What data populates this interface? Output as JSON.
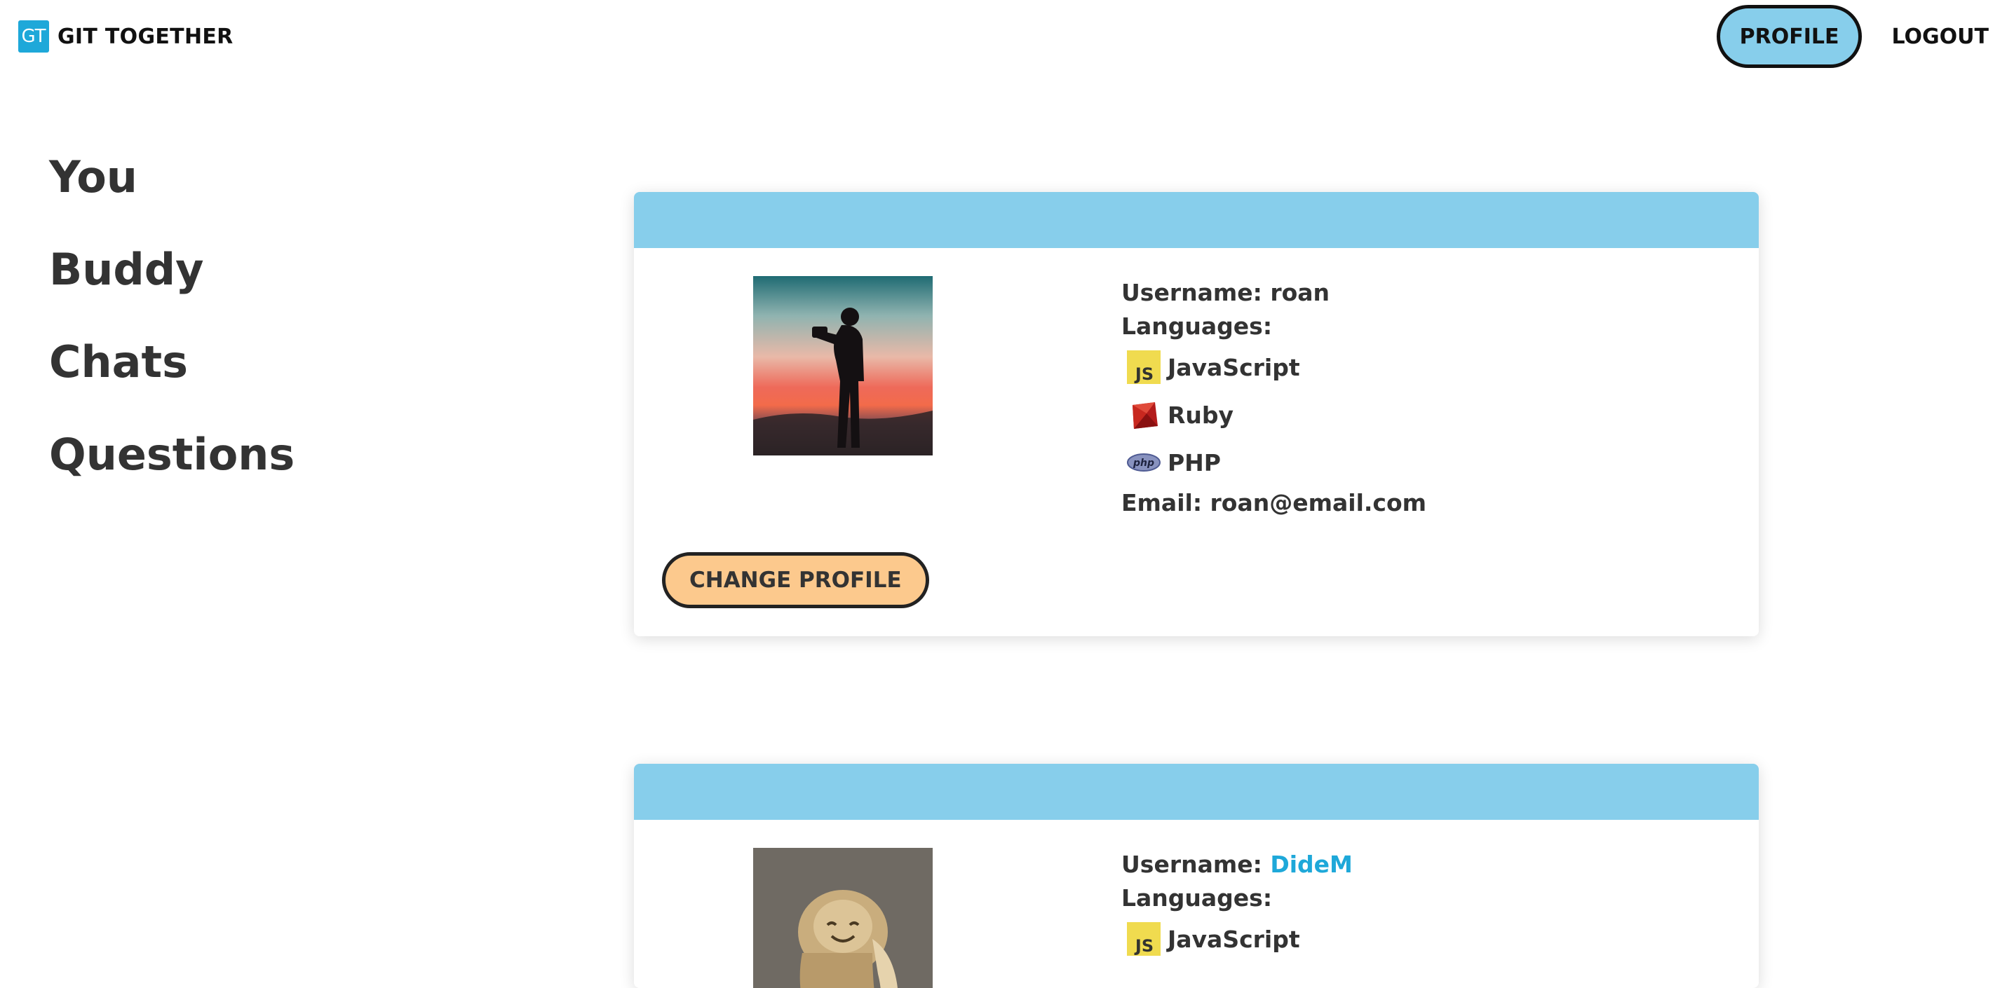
{
  "navbar": {
    "logo_text": "GT",
    "brand": "GIT TOGETHER",
    "profile_label": "PROFILE",
    "logout_label": "LOGOUT"
  },
  "sidebar": {
    "items": [
      {
        "label": "You"
      },
      {
        "label": "Buddy"
      },
      {
        "label": "Chats"
      },
      {
        "label": "Questions"
      }
    ]
  },
  "cards": [
    {
      "photo": "man-with-camera-sunset",
      "username_prefix": "Username:",
      "username": "roan",
      "languages_label": "Languages:",
      "languages": [
        {
          "name": "JavaScript",
          "icon": "javascript-icon",
          "icon_text": "JS"
        },
        {
          "name": "Ruby",
          "icon": "ruby-icon"
        },
        {
          "name": "PHP",
          "icon": "php-icon",
          "icon_text": "php"
        }
      ],
      "email_prefix": "Email:",
      "email": "roan@email.com",
      "change_label": "CHANGE PROFILE"
    },
    {
      "photo": "carved-figurine",
      "username_prefix": "Username:",
      "username": "DideM",
      "languages_label": "Languages:",
      "languages": [
        {
          "name": "JavaScript",
          "icon": "javascript-icon",
          "icon_text": "JS"
        }
      ]
    }
  ],
  "colors": {
    "accent_blue": "#87ceeb",
    "brand_blue": "#1ea8d9",
    "button_orange": "#fcc98d",
    "text": "#333333"
  }
}
